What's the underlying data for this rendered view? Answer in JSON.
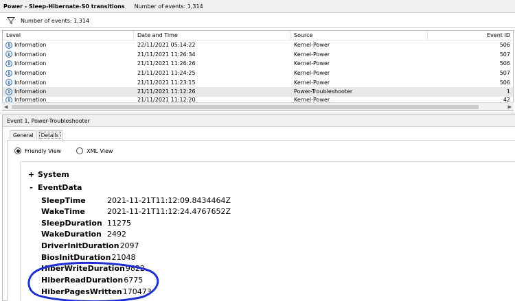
{
  "title_bar": {
    "title": "Power - Sleep-Hibernate-S0 transitions",
    "event_count": "Number of events: 1,314"
  },
  "filter_bar": {
    "icon": "filter-icon",
    "text": "Number of events: 1,314"
  },
  "events_grid": {
    "headers": [
      "Level",
      "Date and Time",
      "Source",
      "Event ID"
    ],
    "rows": [
      {
        "level": "Information",
        "date": "22/11/2021 05:14:22",
        "source": "Kernel-Power",
        "id": "506"
      },
      {
        "level": "Information",
        "date": "21/11/2021 11:26:34",
        "source": "Kernel-Power",
        "id": "507"
      },
      {
        "level": "Information",
        "date": "21/11/2021 11:26:26",
        "source": "Kernel-Power",
        "id": "506"
      },
      {
        "level": "Information",
        "date": "21/11/2021 11:24:25",
        "source": "Kernel-Power",
        "id": "507"
      },
      {
        "level": "Information",
        "date": "21/11/2021 11:23:15",
        "source": "Kernel-Power",
        "id": "506"
      },
      {
        "level": "Information",
        "date": "21/11/2021 11:12:26",
        "source": "Power-Troubleshooter",
        "id": "1"
      },
      {
        "level": "Information",
        "date": "21/11/2021 11:12:20",
        "source": "Kernel-Power",
        "id": "42"
      }
    ],
    "selected_index": 5
  },
  "detail": {
    "header": "Event 1, Power-Troubleshooter",
    "tabs": [
      "General",
      "Details"
    ],
    "active_tab": "Details",
    "views": [
      "Friendly View",
      "XML View"
    ],
    "selected_view": "Friendly View",
    "tree": {
      "system": {
        "toggle": "+",
        "label": "System"
      },
      "eventdata": {
        "toggle": "-",
        "label": "EventData"
      }
    },
    "event_data": [
      {
        "key": "SleepTime",
        "value": "2021-11-21T11:12:09.8434464Z"
      },
      {
        "key": "WakeTime",
        "value": "2021-11-21T11:12:24.4767652Z"
      },
      {
        "key": "SleepDuration",
        "value": "11275"
      },
      {
        "key": "WakeDuration",
        "value": "2492"
      },
      {
        "key": "DriverInitDuration",
        "value": "2097"
      },
      {
        "key": "BiosInitDuration",
        "value": "21048"
      },
      {
        "key": "HiberWriteDuration",
        "value": "9822"
      },
      {
        "key": "HiberReadDuration",
        "value": "6775"
      },
      {
        "key": "HiberPagesWritten",
        "value": "170473"
      }
    ]
  },
  "colors": {
    "annotation": "#1f2fd0",
    "selected_row": "#e8e8e8",
    "info_icon": "#3a6ea5"
  }
}
